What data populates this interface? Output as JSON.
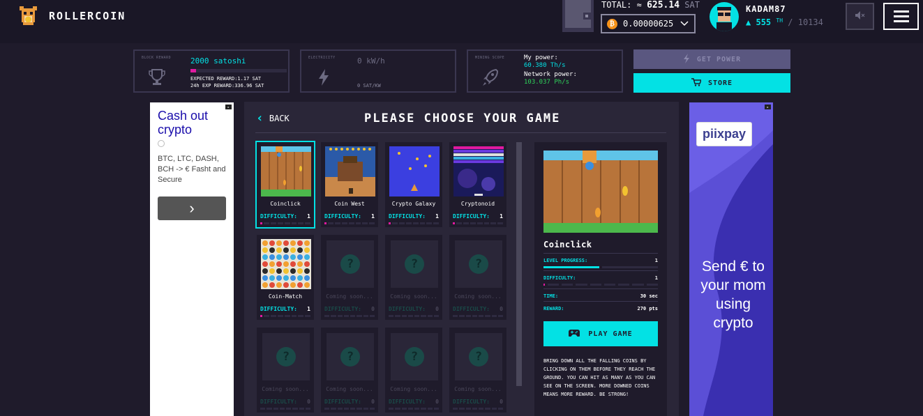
{
  "header": {
    "logo_text": "ROLLERCOIN",
    "total_label": "TOTAL:",
    "total_approx": "≈",
    "total_value": "625.14",
    "total_unit": "SAT",
    "balance": "0.00000625",
    "username": "KADAM87",
    "power_current": "555",
    "power_unit": "TH",
    "power_max": "/ 10134"
  },
  "stats": {
    "block_reward_label": "BLOCK REWARD",
    "block_reward_value": "2000 satoshi",
    "block_reward_progress": 0.06,
    "expected_reward": "EXPECTED REWARD:1.17 SAT",
    "exp_reward_24h": "24h EXP REWARD:336.96 SAT",
    "electricity_label": "ELECTRICITY",
    "electricity_value": "0 kW/h",
    "electricity_sub": "0 SAT/KW",
    "mining_scope_label": "MINING SCOPE",
    "my_power_label": "My power:",
    "my_power_value": "60.380 Th/s",
    "network_power_label": "Network power:",
    "network_power_value": "103.037 Ph/s",
    "get_power_label": "GET POWER",
    "store_label": "STORE"
  },
  "ad_left": {
    "title": "Cash out crypto",
    "description": "BTC, LTC, DASH, BCH -> €  Fasht and Secure",
    "cta": "›"
  },
  "main": {
    "back_label": "BACK",
    "page_title": "PLEASE CHOOSE YOUR GAME",
    "games": [
      {
        "name": "Coinclick",
        "difficulty_label": "DIFFICULTY:",
        "difficulty": "1",
        "difficulty_level": 1
      },
      {
        "name": "Coin West",
        "difficulty_label": "DIFFICULTY:",
        "difficulty": "1",
        "difficulty_level": 1
      },
      {
        "name": "Crypto Galaxy",
        "difficulty_label": "DIFFICULTY:",
        "difficulty": "1",
        "difficulty_level": 1
      },
      {
        "name": "Cryptonoid",
        "difficulty_label": "DIFFICULTY:",
        "difficulty": "1",
        "difficulty_level": 1
      },
      {
        "name": "Coin-Match",
        "difficulty_label": "DIFFICULTY:",
        "difficulty": "1",
        "difficulty_level": 1
      },
      {
        "name": "Coming soon...",
        "difficulty_label": "DIFFICULTY:",
        "difficulty": "0",
        "difficulty_level": 0
      },
      {
        "name": "Coming soon...",
        "difficulty_label": "DIFFICULTY:",
        "difficulty": "0",
        "difficulty_level": 0
      },
      {
        "name": "Coming soon...",
        "difficulty_label": "DIFFICULTY:",
        "difficulty": "0",
        "difficulty_level": 0
      },
      {
        "name": "Coming soon...",
        "difficulty_label": "DIFFICULTY:",
        "difficulty": "0",
        "difficulty_level": 0
      },
      {
        "name": "Coming soon...",
        "difficulty_label": "DIFFICULTY:",
        "difficulty": "0",
        "difficulty_level": 0
      },
      {
        "name": "Coming soon...",
        "difficulty_label": "DIFFICULTY:",
        "difficulty": "0",
        "difficulty_level": 0
      },
      {
        "name": "Coming soon...",
        "difficulty_label": "DIFFICULTY:",
        "difficulty": "0",
        "difficulty_level": 0
      }
    ]
  },
  "detail": {
    "name": "Coinclick",
    "level_progress_label": "LEVEL PROGRESS:",
    "level_progress": "1",
    "difficulty_label": "DIFFICULTY:",
    "difficulty": "1",
    "time_label": "TIME:",
    "time": "30 sec",
    "reward_label": "REWARD:",
    "reward": "270 pts",
    "play_label": "PLAY GAME",
    "description": "BRING DOWN ALL THE FALLING COINS BY CLICKING ON THEM BEFORE THEY REACH THE GROUND. YOU CAN HIT AS MANY AS YOU CAN SEE ON THE SCREEN. MORE DOWNED COINS MEANS MORE REWARD. BE STRONG!"
  },
  "ad_right": {
    "brand": "piixpay",
    "message": "Send € to your mom using crypto"
  },
  "colors": {
    "accent": "#03e1e4",
    "magenta": "#e01aa0",
    "green": "#2fd35a",
    "background": "#1f1b2b",
    "panel": "#2a2638"
  }
}
